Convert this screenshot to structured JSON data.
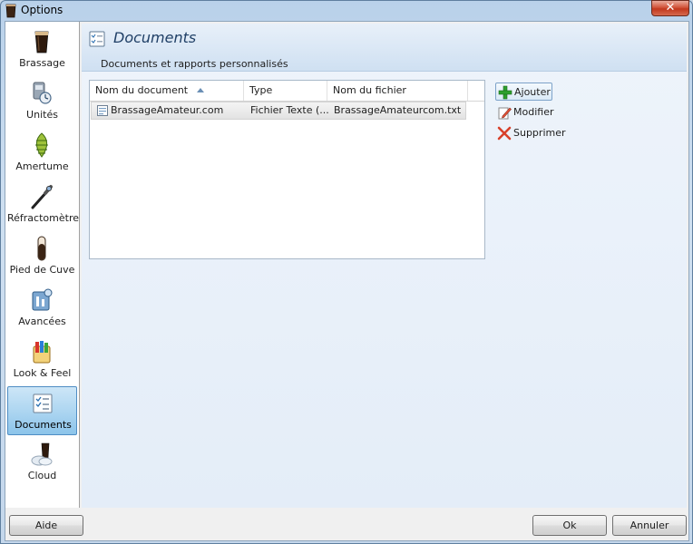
{
  "window": {
    "title": "Options",
    "close_label": "✕"
  },
  "sidebar": {
    "items": [
      {
        "label": "Brassage",
        "icon": "beer-glass-icon"
      },
      {
        "label": "Unités",
        "icon": "units-scale-icon"
      },
      {
        "label": "Amertume",
        "icon": "hop-icon"
      },
      {
        "label": "Réfractomètre",
        "icon": "refractometer-icon"
      },
      {
        "label": "Pied de Cuve",
        "icon": "test-tube-icon"
      },
      {
        "label": "Avancées",
        "icon": "advanced-settings-icon"
      },
      {
        "label": "Look & Feel",
        "icon": "paint-icon"
      },
      {
        "label": "Documents",
        "icon": "document-checklist-icon",
        "selected": true
      },
      {
        "label": "Cloud",
        "icon": "cloud-icon"
      }
    ]
  },
  "header": {
    "title": "Documents",
    "subtitle": "Documents et rapports personnalisés"
  },
  "table": {
    "columns": [
      "Nom du document",
      "Type",
      "Nom du fichier"
    ],
    "rows": [
      {
        "name": "BrassageAmateur.com",
        "type": "Fichier Texte (...",
        "file": "BrassageAmateurcom.txt"
      }
    ]
  },
  "actions": {
    "add": "Ajouter",
    "edit": "Modifier",
    "delete": "Supprimer"
  },
  "footer": {
    "help": "Aide",
    "ok": "Ok",
    "cancel": "Annuler"
  },
  "colors": {
    "selection": "#aed6f1",
    "header_title": "#1f3f66",
    "add_green": "#2ea02e",
    "delete_red": "#d8402a"
  }
}
